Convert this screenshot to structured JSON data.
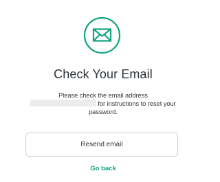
{
  "colors": {
    "accent": "#10a37f",
    "text": "#2d333a",
    "border": "#c9cdd2",
    "redaction": "#ececec"
  },
  "icon": "envelope-icon",
  "title": "Check Your Email",
  "message": {
    "line1": "Please check the email address",
    "line2_suffix": "for instructions to reset your",
    "line3": "password."
  },
  "resend_button_label": "Resend email",
  "go_back_label": "Go back"
}
